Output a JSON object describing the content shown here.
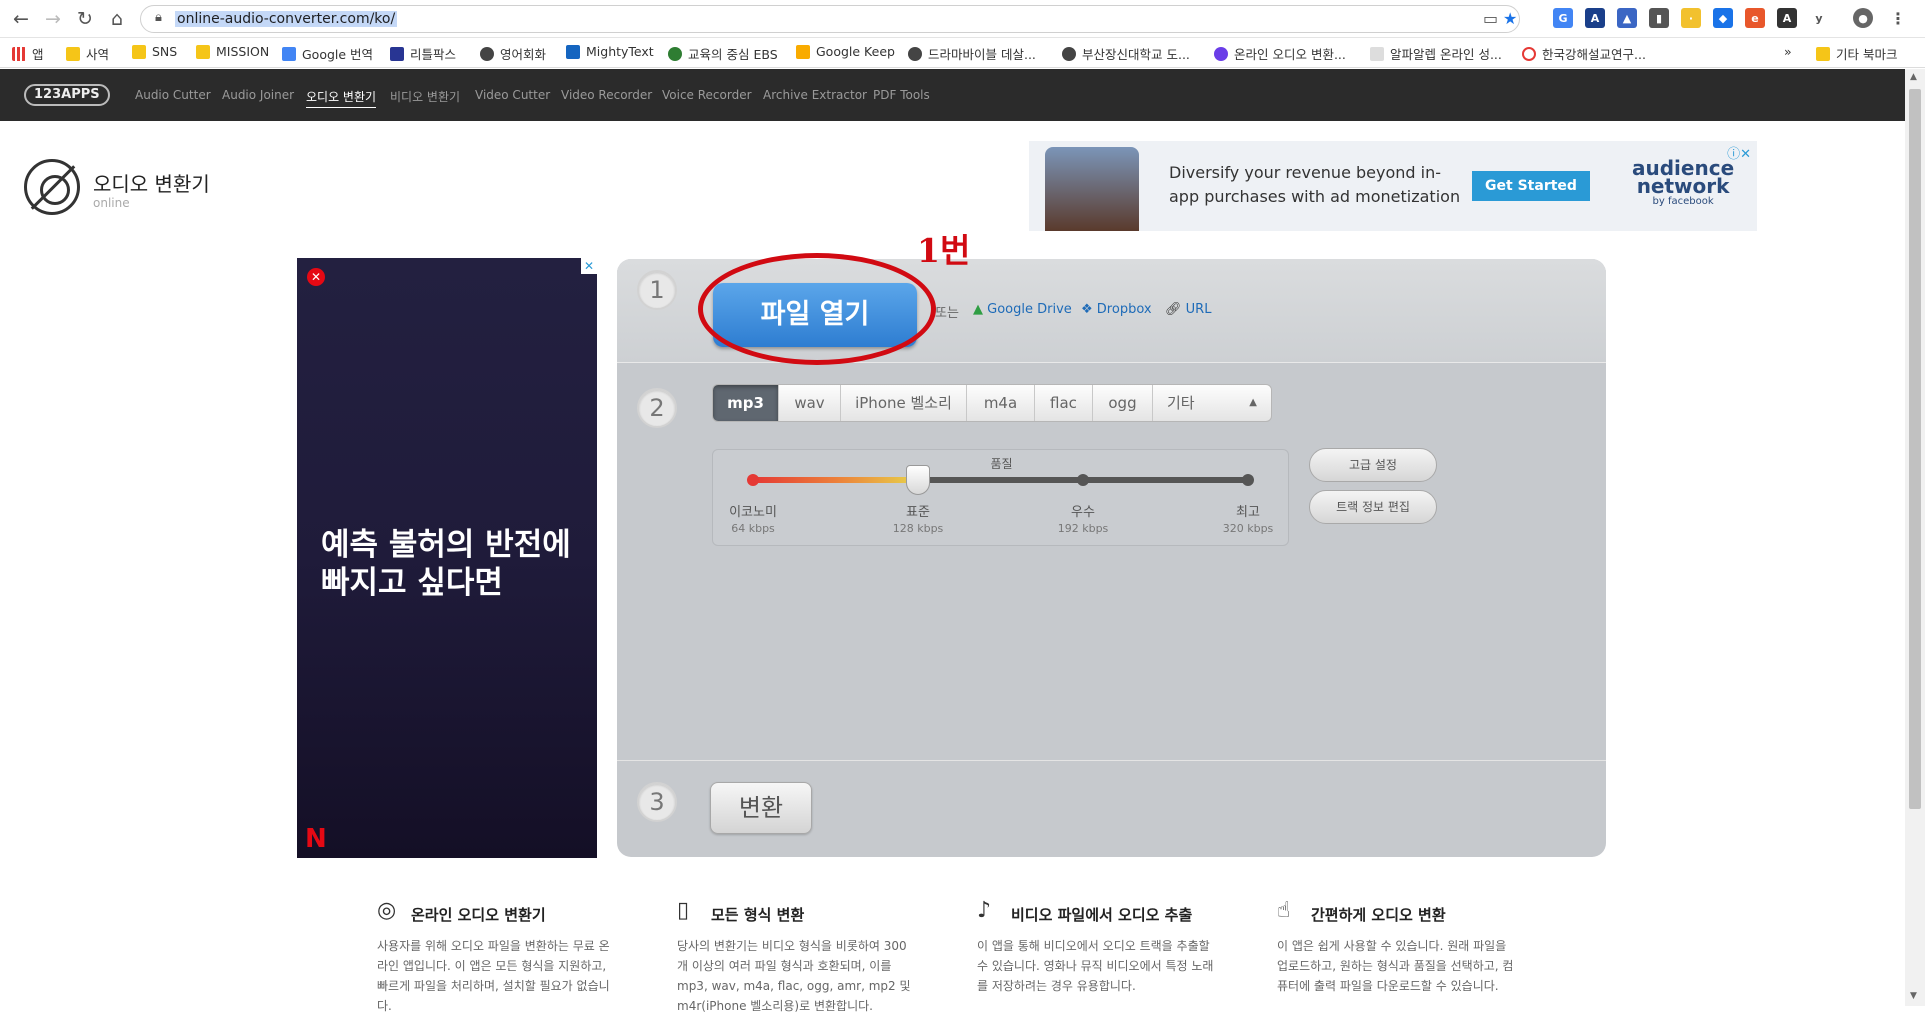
{
  "browser": {
    "url": "online-audio-converter.com/ko/",
    "bookmarks": [
      "앱",
      "사역",
      "SNS",
      "MISSION",
      "Google 번역",
      "리틀팍스",
      "영어회화",
      "MightyText",
      "교육의 중심 EBS",
      "Google Keep",
      "드라마바이블 데살...",
      "부산장신대학교 도...",
      "온라인 오디오 변환...",
      "알파알렙 온라인 성...",
      "한국강해설교연구..."
    ],
    "other_bookmarks": "기타 북마크",
    "more_bookmarks": "»"
  },
  "site_nav": {
    "logo": "123APPS",
    "links": [
      "Audio Cutter",
      "Audio Joiner",
      "오디오 변환기",
      "비디오 변환기",
      "Video Cutter",
      "Video Recorder",
      "Voice Recorder",
      "Archive Extractor",
      "PDF Tools"
    ]
  },
  "app": {
    "title": "오디오 변환기",
    "subtitle": "online"
  },
  "top_ad": {
    "text": "Diversify your revenue beyond in-app purchases with ad monetization",
    "cta": "Get Started",
    "brand_line1": "audience",
    "brand_line2": "network",
    "brand_by": "by facebook",
    "close": "ⓘ✕"
  },
  "side_ad": {
    "headline": "예측 불허의 반전에 빠지고 싶다면",
    "brand": "N",
    "close": "✕",
    "info": "✕"
  },
  "step1": {
    "number": "1",
    "open_button": "파일 열기",
    "or_text": "또는",
    "google_drive": "Google Drive",
    "dropbox": "Dropbox",
    "url": "URL"
  },
  "step2": {
    "number": "2",
    "formats": [
      "mp3",
      "wav",
      "iPhone 벨소리",
      "m4a",
      "flac",
      "ogg",
      "기타"
    ],
    "quality_title": "품질",
    "quality_level": 1,
    "quality_steps": [
      {
        "label": "이코노미",
        "kbps": "64 kbps"
      },
      {
        "label": "표준",
        "kbps": "128 kbps"
      },
      {
        "label": "우수",
        "kbps": "192 kbps"
      },
      {
        "label": "최고",
        "kbps": "320 kbps"
      }
    ],
    "advanced": "고급 설정",
    "track_info": "트랙 정보 편집"
  },
  "step3": {
    "number": "3",
    "convert": "변환"
  },
  "annotation": {
    "label": "1번",
    "color": "#d10a12"
  },
  "features": [
    {
      "title": "온라인 오디오 변환기",
      "desc": "사용자를 위해 오디오 파일을 변환하는 무료 온라인 앱입니다. 이 앱은 모든 형식을 지원하고, 빠르게 파일을 처리하며, 설치할 필요가 없습니다."
    },
    {
      "title": "모든 형식 변환",
      "desc": "당사의 변환기는 비디오 형식을 비롯하여 300개 이상의 여러 파일 형식과 호환되며, 이를 mp3, wav, m4a, flac, ogg, amr, mp2 및 m4r(iPhone 벨소리용)로 변환합니다."
    },
    {
      "title": "비디오 파일에서 오디오 추출",
      "desc": "이 앱을 통해 비디오에서 오디오 트랙을 추출할 수 있습니다. 영화나 뮤직 비디오에서 특정 노래를 저장하려는 경우 유용합니다."
    },
    {
      "title": "간편하게 오디오 변환",
      "desc": "이 앱은 쉽게 사용할 수 있습니다. 원래 파일을 업로드하고, 원하는 형식과 품질을 선택하고, 컴퓨터에 출력 파일을 다운로드할 수 있습니다."
    }
  ]
}
